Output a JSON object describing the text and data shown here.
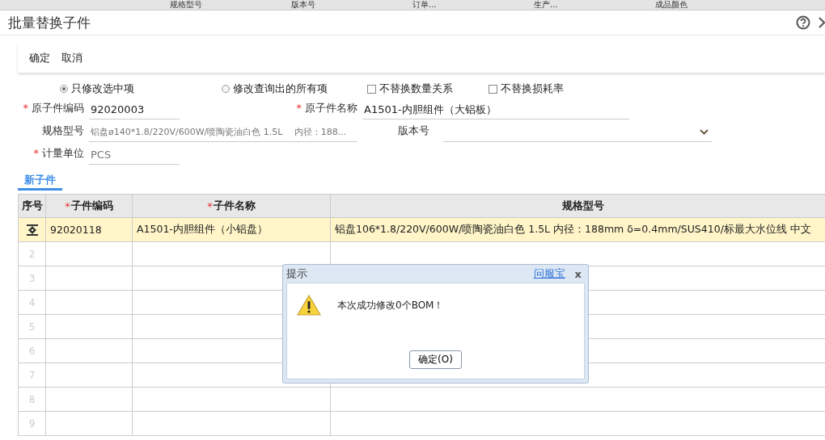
{
  "background_header": [
    "规格型号",
    "版本号",
    "订单...",
    "生产...",
    "成品颜色"
  ],
  "window": {
    "title": "批量替换子件"
  },
  "toolbar": [
    "确定",
    "取消"
  ],
  "options": [
    {
      "kind": "radio",
      "label": "只修改选中项",
      "selected": true
    },
    {
      "kind": "radio",
      "label": "修改查询出的所有项",
      "selected": false
    },
    {
      "kind": "checkbox",
      "label": "不替换数量关系",
      "checked": false
    },
    {
      "kind": "checkbox",
      "label": "不替换损耗率",
      "checked": false
    }
  ],
  "fields": {
    "orig_code": {
      "required_mark": "*",
      "label": "原子件编码",
      "value": "92020003"
    },
    "orig_name": {
      "required_mark": "*",
      "label": "原子件名称",
      "value": "A1501-内胆组件（大铝板）"
    },
    "spec": {
      "label": "规格型号",
      "value": "铝盘ø140*1.8/220V/600W/喷陶瓷油白色 1.5L　 内径：188..."
    },
    "version": {
      "label": "版本号"
    },
    "unit": {
      "required_mark": "*",
      "label": "计量单位",
      "value": "PCS"
    }
  },
  "tabs": [
    {
      "label": "新子件",
      "selected": true
    }
  ],
  "table": {
    "columns": [
      {
        "label": "序号"
      },
      {
        "required_mark": "*",
        "label": "子件编码"
      },
      {
        "required_mark": "*",
        "label": "子件名称"
      },
      {
        "label": "规格型号"
      }
    ],
    "rows": [
      {
        "selected": true,
        "cells": [
          "",
          "92020118",
          "A1501-内胆组件（小铝盘）",
          "铝盘106*1.8/220V/600W/喷陶瓷油白色 1.5L 内径：188mm δ=0.4mm/SUS410/标最大水位线 中文"
        ]
      },
      {
        "selected": false,
        "cells": [
          "2",
          "",
          "",
          ""
        ]
      },
      {
        "selected": false,
        "cells": [
          "3",
          "",
          "",
          ""
        ]
      },
      {
        "selected": false,
        "cells": [
          "4",
          "",
          "",
          ""
        ]
      },
      {
        "selected": false,
        "cells": [
          "5",
          "",
          "",
          ""
        ]
      },
      {
        "selected": false,
        "cells": [
          "6",
          "",
          "",
          ""
        ]
      },
      {
        "selected": false,
        "cells": [
          "7",
          "",
          "",
          ""
        ]
      },
      {
        "selected": false,
        "cells": [
          "8",
          "",
          "",
          ""
        ]
      },
      {
        "selected": false,
        "cells": [
          "9",
          "",
          "",
          ""
        ]
      }
    ]
  },
  "dialog": {
    "title": "提示",
    "link": "问服宝",
    "close": "x",
    "message": "本次成功修改0个BOM！",
    "button": "确定(O)"
  }
}
